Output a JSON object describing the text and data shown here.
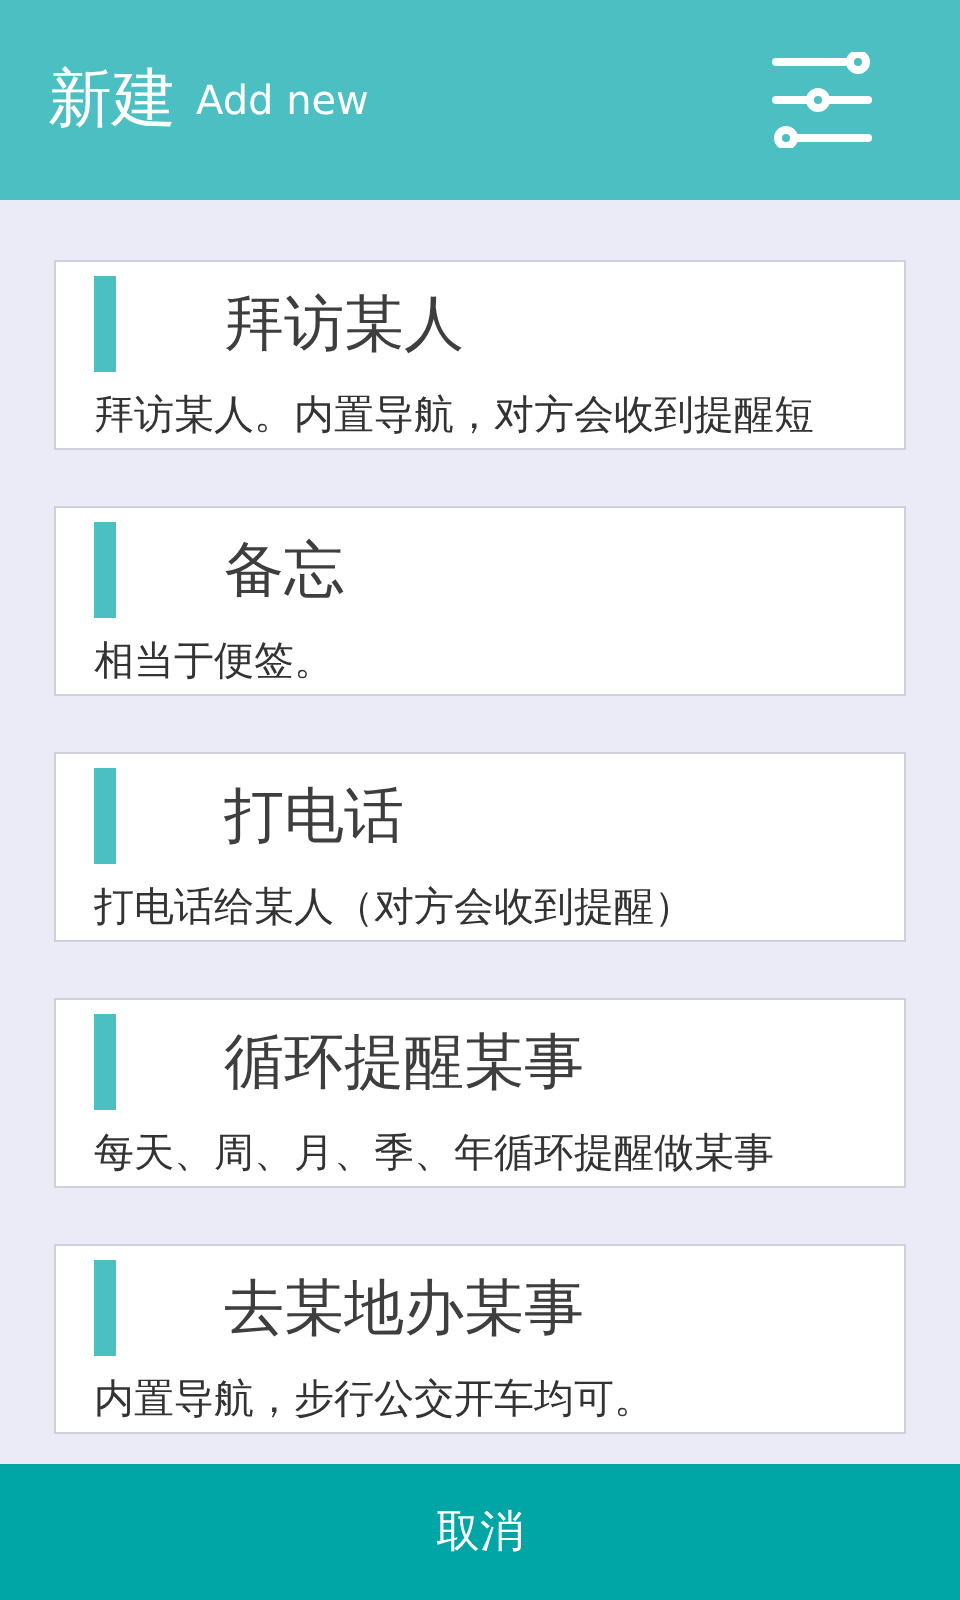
{
  "header": {
    "title": "新建",
    "subtitle": "Add new"
  },
  "items": [
    {
      "title": "拜访某人",
      "description": "拜访某人。内置导航，对方会收到提醒短"
    },
    {
      "title": "备忘",
      "description": "相当于便签。"
    },
    {
      "title": "打电话",
      "description": "打电话给某人（对方会收到提醒）"
    },
    {
      "title": "循环提醒某事",
      "description": "每天、周、月、季、年循环提醒做某事"
    },
    {
      "title": "去某地办某事",
      "description": "内置导航，步行公交开车均可。"
    }
  ],
  "cancel_button": "取消"
}
